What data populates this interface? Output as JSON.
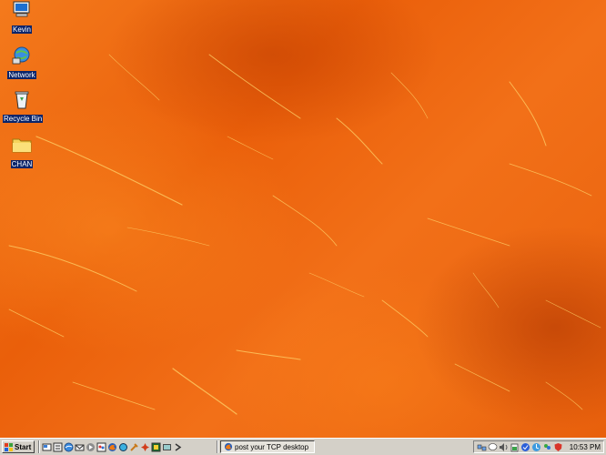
{
  "desktop": {
    "icons": [
      {
        "label": "Kevin",
        "icon": "my-computer-icon"
      },
      {
        "label": "Network",
        "icon": "network-icon"
      },
      {
        "label": "Recycle Bin",
        "icon": "recycle-bin-icon"
      },
      {
        "label": "CHAN",
        "icon": "folder-icon"
      }
    ],
    "wallpaper": {
      "base": "#f06a10",
      "streak": "#ffd36a"
    }
  },
  "taskbar": {
    "start_label": "Start",
    "quick_launch": [
      "show-desktop-icon",
      "explorer-icon",
      "internet-icon",
      "outlook-icon",
      "media-icon",
      "paint-icon",
      "firefox-icon",
      "app-icon",
      "tool-icon",
      "settings-icon",
      "monitor-icon",
      "app2-icon",
      "arrow-icon"
    ],
    "task_button": {
      "label": "post your TCP desktop",
      "icon": "firefox-icon"
    },
    "tray_icons": [
      "network-tray-icon",
      "chat-tray-icon",
      "volume-icon",
      "battery-icon",
      "security-icon",
      "update-icon",
      "messenger-icon",
      "shield-icon"
    ],
    "clock": "10:53 PM"
  }
}
